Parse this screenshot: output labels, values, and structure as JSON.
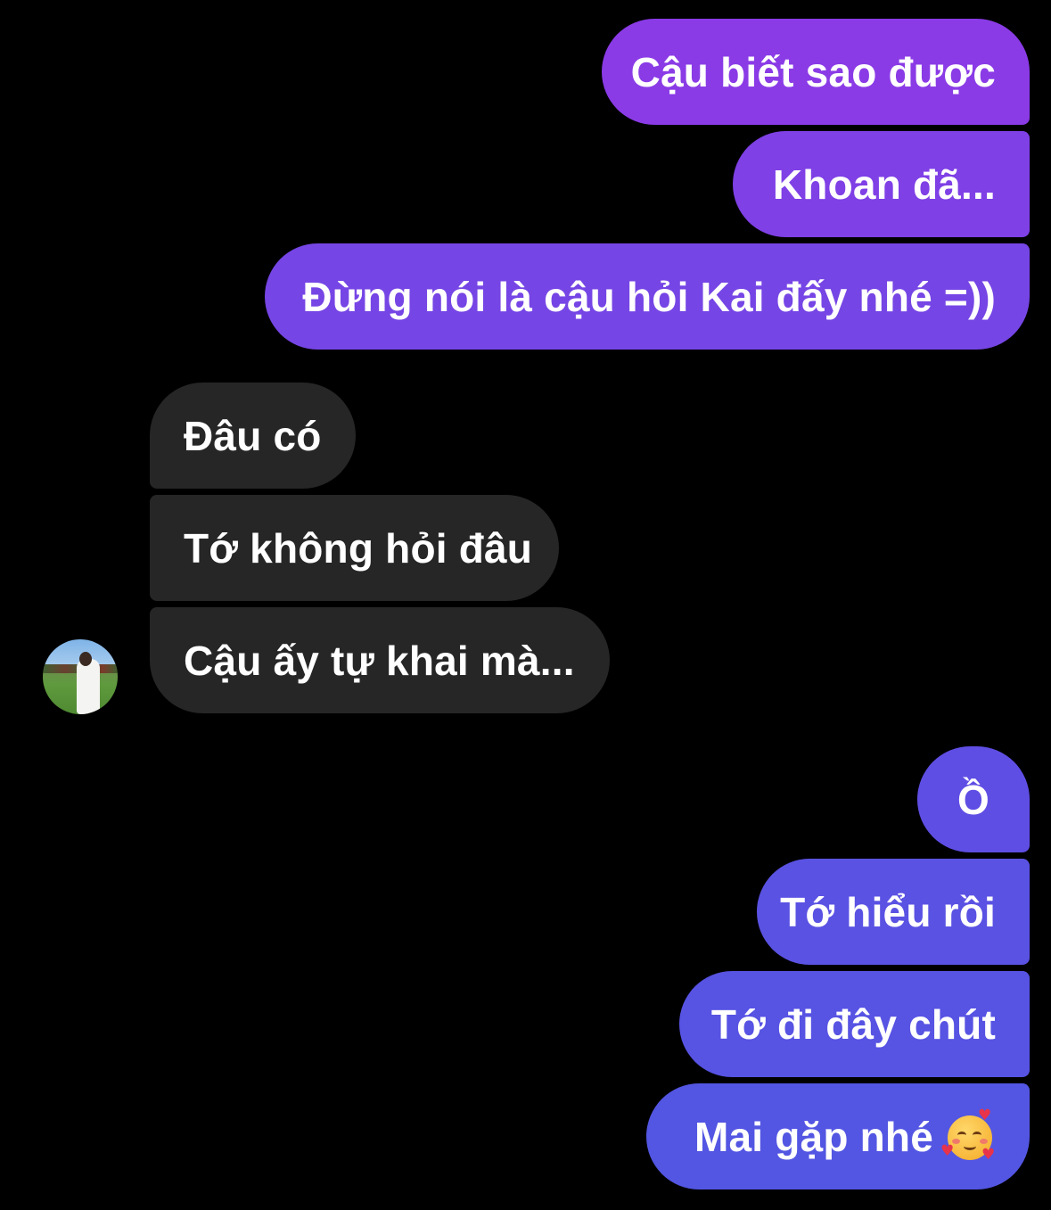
{
  "conversation": {
    "outgoing_group_1": [
      "Cậu biết sao được",
      "Khoan đã...",
      "Đừng nói là cậu hỏi Kai đấy nhé =))"
    ],
    "incoming_group": [
      "Đâu có",
      "Tớ không hỏi đâu",
      "Cậu ấy tự khai mà..."
    ],
    "outgoing_group_2": [
      "Ồ",
      "Tớ hiểu rồi",
      "Tớ đi đây chút",
      "Mai gặp nhé"
    ]
  },
  "icons": {
    "avatar": "contact-avatar-photo",
    "last_message_emoji": "smiling-face-with-hearts-emoji"
  },
  "colors": {
    "background": "#000000",
    "incoming_bubble": "#262626",
    "outgoing_gradient_top": "#8a3be6",
    "outgoing_gradient_bottom": "#5356e2",
    "text": "#ffffff"
  }
}
